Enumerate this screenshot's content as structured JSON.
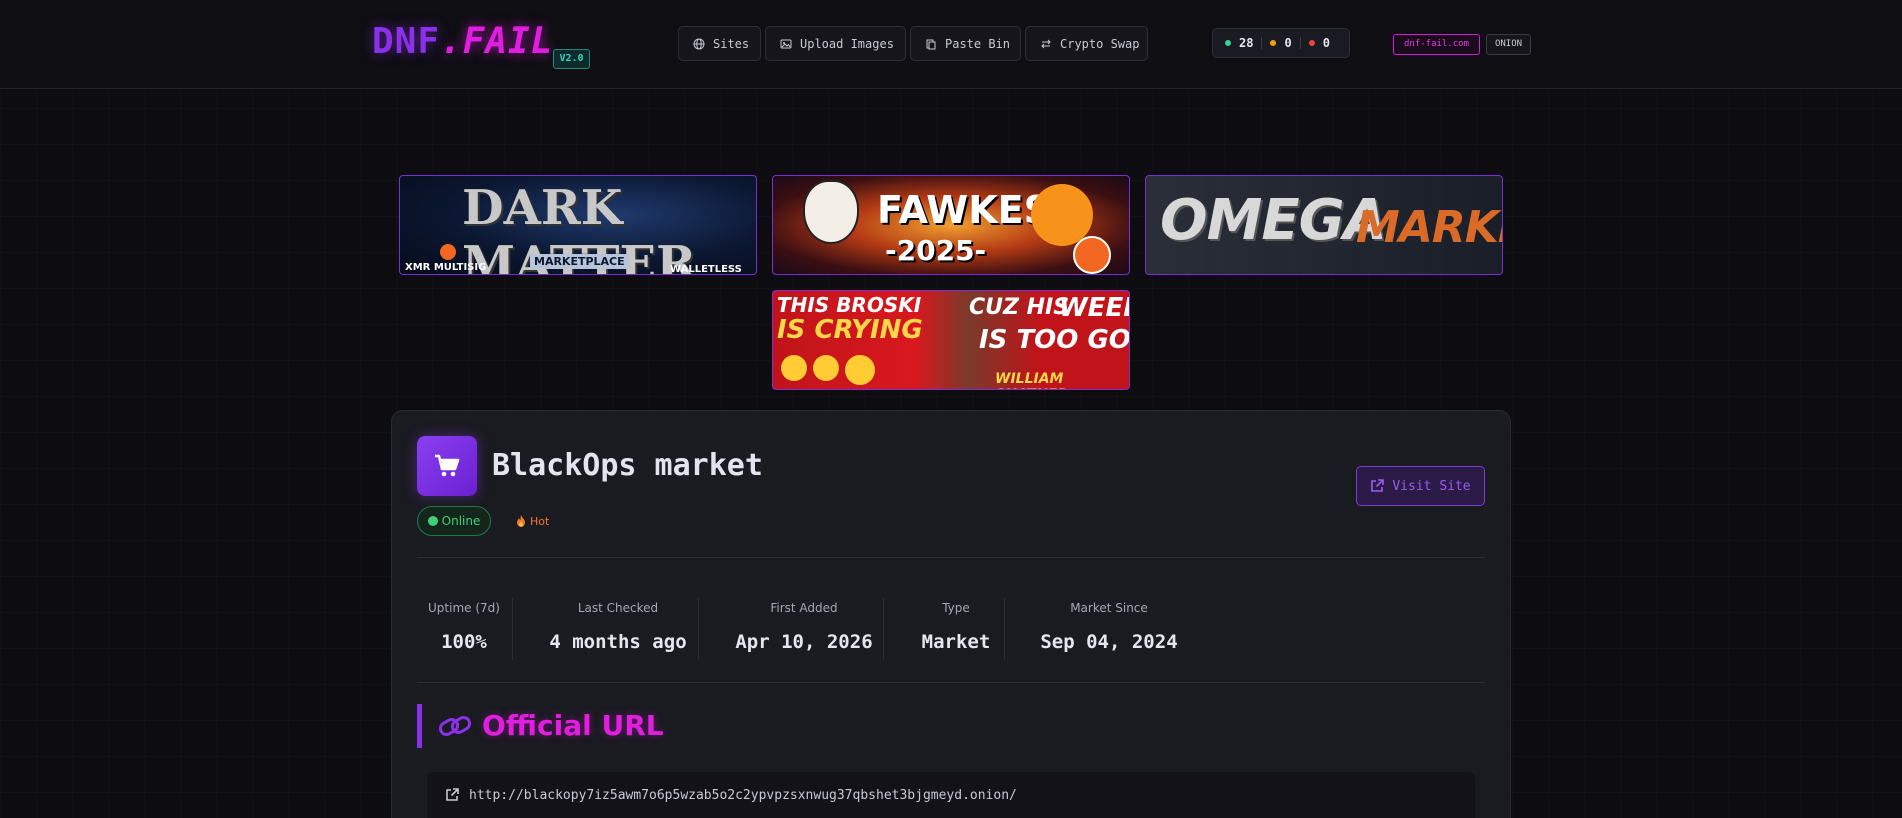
{
  "header": {
    "logo_part1": "DNF",
    "logo_part2": ".FAIL",
    "version": "V2.0",
    "nav": [
      {
        "label": "Sites",
        "icon": "globe-icon"
      },
      {
        "label": "Upload Images",
        "icon": "image-icon"
      },
      {
        "label": "Paste Bin",
        "icon": "clipboard-icon"
      },
      {
        "label": "Crypto Swap",
        "icon": "swap-icon"
      }
    ],
    "stats": {
      "online": "28",
      "online_color": "#34d399",
      "warning": "0",
      "warning_color": "#f59e0b",
      "offline": "0",
      "offline_color": "#ef4444"
    },
    "domain_chip": "dnf-fail.com",
    "onion_chip": "ONION"
  },
  "banners": [
    {
      "name": "dark-matter-banner",
      "title_a": "DARK",
      "title_b": "MATTER",
      "sub1": "XMR MULTISIG",
      "sub2": "MARKETPLACE",
      "sub3": "WALLETLESS"
    },
    {
      "name": "fawkes-banner",
      "title": "FAWKES",
      "year": "-2025-"
    },
    {
      "name": "omega-banner",
      "title_a": "OMEGA",
      "title_b": "MARKET"
    },
    {
      "name": "broski-banner",
      "line1": "THIS BROSKI",
      "line2": "IS CRYING",
      "line3": "CUZ HIS",
      "line4": "WEED",
      "line5": "IS TOO GOOD",
      "line6": "WILLIAM SHATNER"
    }
  ],
  "site": {
    "title": "BlackOps market",
    "status": "Online",
    "status_color": "#3fd07a",
    "tag": "Hot",
    "visit_label": "Visit Site",
    "stats": [
      {
        "label": "Uptime (7d)",
        "value": "100%"
      },
      {
        "label": "Last Checked",
        "value": "4 months ago"
      },
      {
        "label": "First Added",
        "value": "Apr 10, 2026"
      },
      {
        "label": "Type",
        "value": "Market"
      },
      {
        "label": "Market Since",
        "value": "Sep 04, 2024"
      }
    ],
    "section_title": "Official URL",
    "url": "http://blackopy7iz5awm7o6p5wzab5o2c2ypvpzsxnwug37qbshet3bjgmeyd.onion/"
  },
  "colors": {
    "accent_purple": "#8b2fe8",
    "accent_magenta": "#e11de0",
    "background": "#0c0c11"
  }
}
